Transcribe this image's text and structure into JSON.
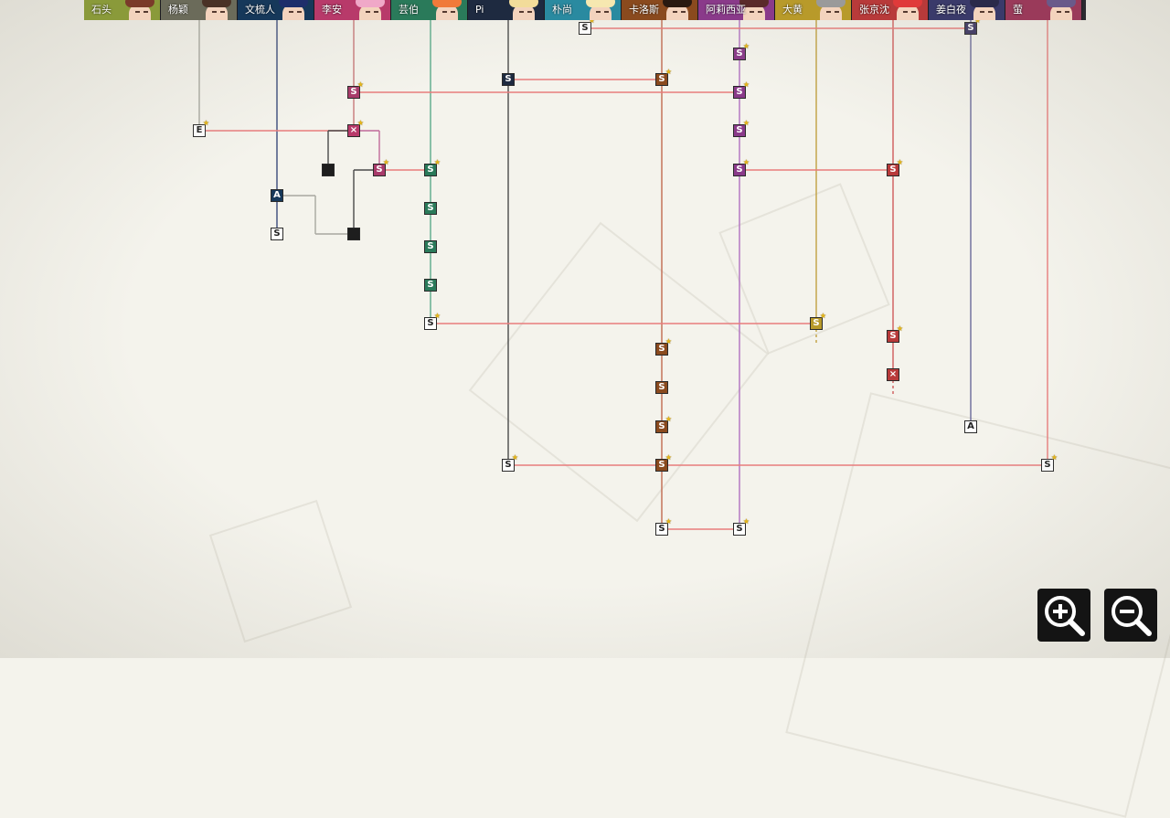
{
  "characters": [
    {
      "name": "石头",
      "theme": "#8a9a3a",
      "hair": "#7a3a2a"
    },
    {
      "name": "杨颖",
      "theme": "#6b6b5a",
      "hair": "#4a3226"
    },
    {
      "name": "文梳人",
      "theme": "#16385a",
      "hair": "#1e2e6a"
    },
    {
      "name": "李安",
      "theme": "#b83a6a",
      "hair": "#f0a8c8"
    },
    {
      "name": "芸伯",
      "theme": "#2a7a5a",
      "hair": "#f07a3a"
    },
    {
      "name": "Pi",
      "theme": "#1e2a40",
      "hair": "#f2dc9a"
    },
    {
      "name": "朴尚",
      "theme": "#2a8aa0",
      "hair": "#f6e8b0"
    },
    {
      "name": "卡洛斯",
      "theme": "#8a4a1e",
      "hair": "#2a1a10"
    },
    {
      "name": "阿莉西亚",
      "theme": "#8a3a8a",
      "hair": "#5a2a2a"
    },
    {
      "name": "大黄",
      "theme": "#b89a2a",
      "hair": "#9a9a9a"
    },
    {
      "name": "张京沈",
      "theme": "#b83a3a",
      "hair": "#e03a3a"
    },
    {
      "name": "姜白夜",
      "theme": "#3a3a6a",
      "hair": "#2a2a4a"
    },
    {
      "name": "萤",
      "theme": "#9a3a5a",
      "hair": "#6a5a8a"
    }
  ],
  "colors": {
    "red_line": "#e87c7c",
    "stone": "#a8a8a0",
    "navy": "#3a4a7a",
    "teal": "#5aaa8a",
    "dark": "#4a4a4a",
    "brown": "#c06a50",
    "purple": "#b070c0",
    "gold": "#c0a040",
    "red": "#d05a5a",
    "slate": "#6a6a9a",
    "magenta": "#c06a9a",
    "pink": "#c8787a"
  },
  "nodes": [
    {
      "label": "S",
      "kind": "white",
      "star": true
    },
    {
      "label": "S",
      "kind": "color",
      "color": "#3a3462",
      "star": true
    },
    {
      "label": "S",
      "kind": "color",
      "color": "#8a3a8a",
      "star": true
    },
    {
      "label": "S",
      "kind": "color",
      "color": "#1e2a40",
      "star": false
    },
    {
      "label": "S",
      "kind": "color",
      "color": "#8a4a1e",
      "star": true
    },
    {
      "label": "S",
      "kind": "color",
      "color": "#a83a6a",
      "star": true
    },
    {
      "label": "S",
      "kind": "color",
      "color": "#8a3a8a",
      "star": true
    },
    {
      "label": "E",
      "kind": "white",
      "star": true
    },
    {
      "label": "×",
      "kind": "color",
      "color": "#b83a6a",
      "star": true
    },
    {
      "label": "S",
      "kind": "color",
      "color": "#8a3a8a",
      "star": true
    },
    {
      "label": "",
      "kind": "black",
      "star": false
    },
    {
      "label": "S",
      "kind": "color",
      "color": "#a83a6a",
      "star": true
    },
    {
      "label": "S",
      "kind": "color",
      "color": "#2a7a5a",
      "star": true
    },
    {
      "label": "S",
      "kind": "color",
      "color": "#8a3a8a",
      "star": true
    },
    {
      "label": "S",
      "kind": "color",
      "color": "#b83a3a",
      "star": true
    },
    {
      "label": "A",
      "kind": "color",
      "color": "#16385a",
      "star": false
    },
    {
      "label": "S",
      "kind": "color",
      "color": "#2a7a5a",
      "star": false
    },
    {
      "label": "S",
      "kind": "white",
      "star": false
    },
    {
      "label": "",
      "kind": "black",
      "star": false
    },
    {
      "label": "S",
      "kind": "color",
      "color": "#2a7a5a",
      "star": false
    },
    {
      "label": "S",
      "kind": "color",
      "color": "#2a7a5a",
      "star": false
    },
    {
      "label": "S",
      "kind": "white",
      "star": true
    },
    {
      "label": "S",
      "kind": "color",
      "color": "#b89a2a",
      "star": true
    },
    {
      "label": "S",
      "kind": "color",
      "color": "#8a4a1e",
      "star": true
    },
    {
      "label": "S",
      "kind": "color",
      "color": "#b83a3a",
      "star": true
    },
    {
      "label": "×",
      "kind": "color",
      "color": "#b83a3a",
      "star": false
    },
    {
      "label": "S",
      "kind": "color",
      "color": "#8a4a1e",
      "star": false
    },
    {
      "label": "S",
      "kind": "color",
      "color": "#8a4a1e",
      "star": true
    },
    {
      "label": "A",
      "kind": "white",
      "star": false
    },
    {
      "label": "S",
      "kind": "white",
      "star": true
    },
    {
      "label": "S",
      "kind": "color",
      "color": "#8a4a1e",
      "star": true
    },
    {
      "label": "S",
      "kind": "white",
      "star": true
    },
    {
      "label": "S",
      "kind": "white",
      "star": true
    },
    {
      "label": "S",
      "kind": "white",
      "star": true
    }
  ],
  "zoom": {
    "in_icon": "zoom-in-icon",
    "out_icon": "zoom-out-icon"
  }
}
